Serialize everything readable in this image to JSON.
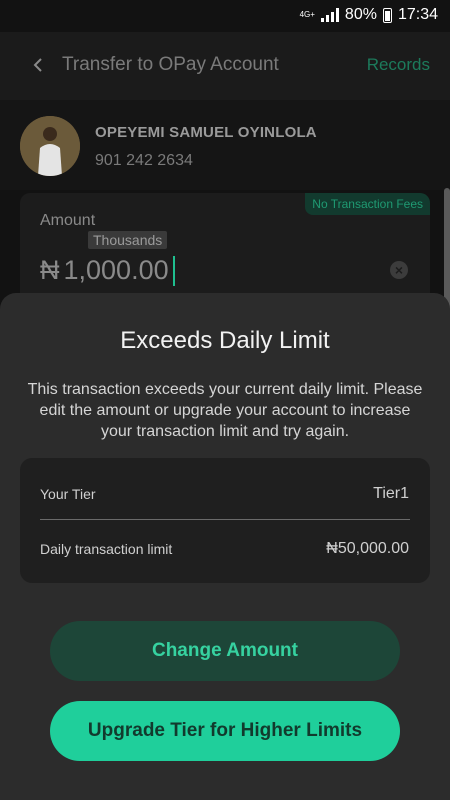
{
  "status_bar": {
    "network": "4G+",
    "battery": "80%",
    "time": "17:34"
  },
  "header": {
    "title": "Transfer to OPay Account",
    "records_label": "Records"
  },
  "recipient": {
    "name": "OPEYEMI SAMUEL OYINLOLA",
    "account_number": "901 242 2634"
  },
  "amount_card": {
    "fee_badge": "No Transaction Fees",
    "label": "Amount",
    "hint": "Thousands",
    "currency_symbol": "₦",
    "value": "1,000.00"
  },
  "dialog": {
    "title": "Exceeds Daily Limit",
    "message": "This transaction exceeds your current daily limit. Please edit the amount or upgrade your account to increase your transaction limit and try again.",
    "tier_label": "Your Tier",
    "tier_value": "Tier1",
    "limit_label": "Daily transaction limit",
    "limit_value": "₦50,000.00",
    "change_button": "Change Amount",
    "upgrade_button": "Upgrade Tier for Higher Limits"
  },
  "colors": {
    "accent": "#1fcf9b",
    "accent_dark": "#1d4638",
    "sheet_bg": "#2c2c2c",
    "background": "#121212"
  }
}
